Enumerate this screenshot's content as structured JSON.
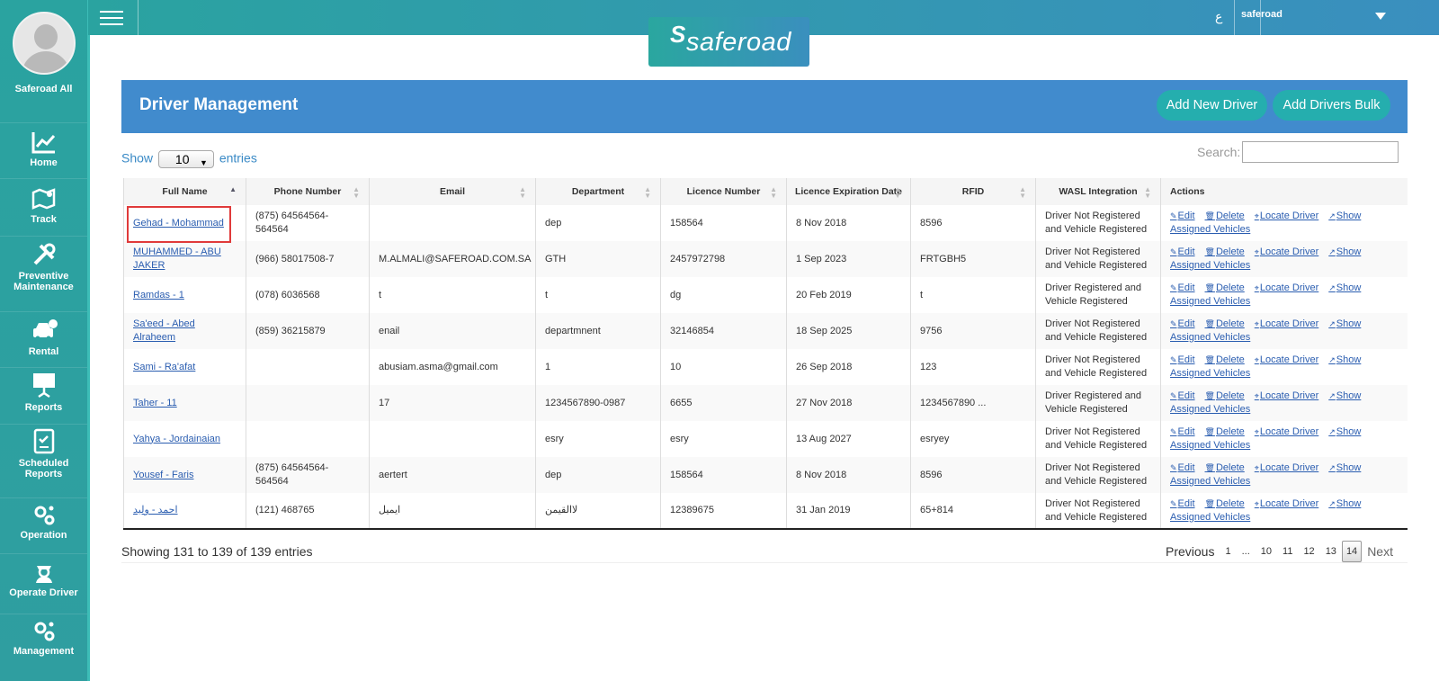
{
  "sidebar": {
    "user_name": "Saferoad All",
    "items": [
      {
        "label": "Home",
        "icon": "chart-icon"
      },
      {
        "label": "Track",
        "icon": "map-icon"
      },
      {
        "label": "Preventive Maintenance",
        "icon": "tools-icon"
      },
      {
        "label": "Rental",
        "icon": "car-dollar-icon"
      },
      {
        "label": "Reports",
        "icon": "presentation-icon"
      },
      {
        "label": "Scheduled Reports",
        "icon": "clipboard-icon"
      },
      {
        "label": "Operation",
        "icon": "gears-icon"
      },
      {
        "label": "Operate Driver",
        "icon": "driver-icon"
      },
      {
        "label": "Management",
        "icon": "gears-icon"
      }
    ]
  },
  "topbar": {
    "lang_label": "ع",
    "user_menu": "saferoad"
  },
  "logo": {
    "text": "saferoad"
  },
  "panel": {
    "title": "Driver Management",
    "add_driver": "Add New Driver",
    "add_bulk": "Add Drivers Bulk"
  },
  "table_controls": {
    "show_label": "Show",
    "entries_label": "entries",
    "page_length": "10",
    "search_label": "Search:",
    "search_value": ""
  },
  "columns": [
    "Full Name",
    "Phone Number",
    "Email",
    "Department",
    "Licence Number",
    "Licence Expiration Date",
    "RFID",
    "WASL Integration",
    "Actions"
  ],
  "rows": [
    {
      "name": "Gehad - Mohammad",
      "phone": "(875) 64564564-564564",
      "email": "",
      "dept": "dep",
      "licence": "158564",
      "expiry": "8 Nov 2018",
      "rfid": "8596",
      "wasl": "Driver Not Registered and Vehicle Registered"
    },
    {
      "name": "MUHAMMED - ABU JAKER",
      "phone": "(966) 58017508-7",
      "email": "M.ALMALI@SAFEROAD.COM.SA",
      "dept": "GTH",
      "licence": "2457972798",
      "expiry": "1 Sep 2023",
      "rfid": "FRTGBH5",
      "wasl": "Driver Not Registered and Vehicle Registered"
    },
    {
      "name": "Ramdas - 1",
      "phone": "(078) 6036568",
      "email": "t",
      "dept": "t",
      "licence": "dg",
      "expiry": "20 Feb 2019",
      "rfid": "t",
      "wasl": "Driver Registered and Vehicle Registered"
    },
    {
      "name": "Sa'eed - Abed Alraheem",
      "phone": "(859) 36215879",
      "email": "enail",
      "dept": "departmnent",
      "licence": "32146854",
      "expiry": "18 Sep 2025",
      "rfid": "9756",
      "wasl": "Driver Not Registered and Vehicle Registered"
    },
    {
      "name": "Sami - Ra'afat",
      "phone": "",
      "email": "abusiam.asma@gmail.com",
      "dept": "1",
      "licence": "10",
      "expiry": "26 Sep 2018",
      "rfid": "123",
      "wasl": "Driver Not Registered and Vehicle Registered"
    },
    {
      "name": "Taher - 11",
      "phone": "",
      "email": "17",
      "dept": "1234567890-0987",
      "licence": "6655",
      "expiry": "27 Nov 2018",
      "rfid": "1234567890 ...",
      "wasl": "Driver Registered and Vehicle Registered"
    },
    {
      "name": "Yahya - Jordainaian",
      "phone": "",
      "email": "",
      "dept": "esry",
      "licence": "esry",
      "expiry": "13 Aug 2027",
      "rfid": "esryey",
      "wasl": "Driver Not Registered and Vehicle Registered"
    },
    {
      "name": "Yousef - Faris",
      "phone": "(875) 64564564-564564",
      "email": "aertert",
      "dept": "dep",
      "licence": "158564",
      "expiry": "8 Nov 2018",
      "rfid": "8596",
      "wasl": "Driver Not Registered and Vehicle Registered"
    },
    {
      "name": "احمد - وليد",
      "phone": "(121) 468765",
      "email": "ايميل",
      "dept": "لاالقيمن",
      "licence": "12389675",
      "expiry": "31 Jan 2019",
      "rfid": "65+814",
      "wasl": "Driver Not Registered and Vehicle Registered"
    }
  ],
  "actions": {
    "edit": "Edit",
    "delete": "Delete",
    "locate": "Locate Driver",
    "show": "Show Assigned Vehicles"
  },
  "footer": {
    "info": "Showing 131 to 139 of 139 entries",
    "previous": "Previous",
    "pages": [
      "1",
      "...",
      "10",
      "11",
      "12",
      "13",
      "14"
    ],
    "current_page": "14",
    "next": "Next"
  },
  "colors": {
    "sidebar": "#2aa3a0",
    "panel_header": "#418bcd",
    "button": "#25aeae",
    "link": "#2a5db0",
    "highlight": "#e03a3a"
  }
}
